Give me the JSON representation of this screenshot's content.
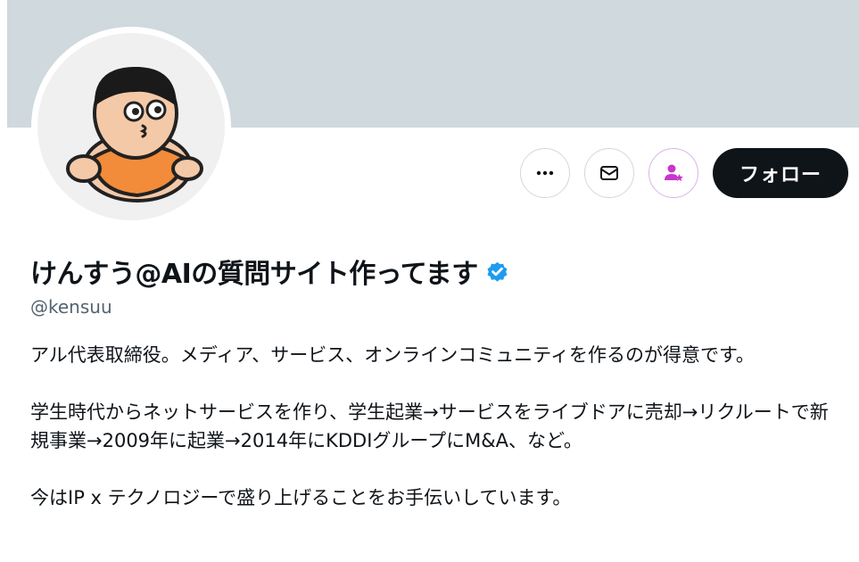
{
  "profile": {
    "display_name": "けんすう@AIの質問サイト作ってます",
    "handle": "@kensuu",
    "verified": true,
    "bio": [
      "アル代表取締役。メディア、サービス、オンラインコミュニティを作るのが得意です。",
      "学生時代からネットサービスを作り、学生起業→サービスをライブドアに売却→リクルートで新規事業→2009年に起業→2014年にKDDIグループにM&A、など。",
      "今はIP x テクノロジーで盛り上げることをお手伝いしています。"
    ]
  },
  "actions": {
    "more_icon": "more-horizontal-icon",
    "message_icon": "envelope-icon",
    "subscribe_icon": "subscribe-star-icon",
    "follow_label": "フォロー"
  },
  "colors": {
    "banner": "#cfd9de",
    "follow_bg": "#0f1419",
    "verified": "#1d9bf0",
    "subscribe": "#c936cc",
    "handle": "#536471"
  }
}
